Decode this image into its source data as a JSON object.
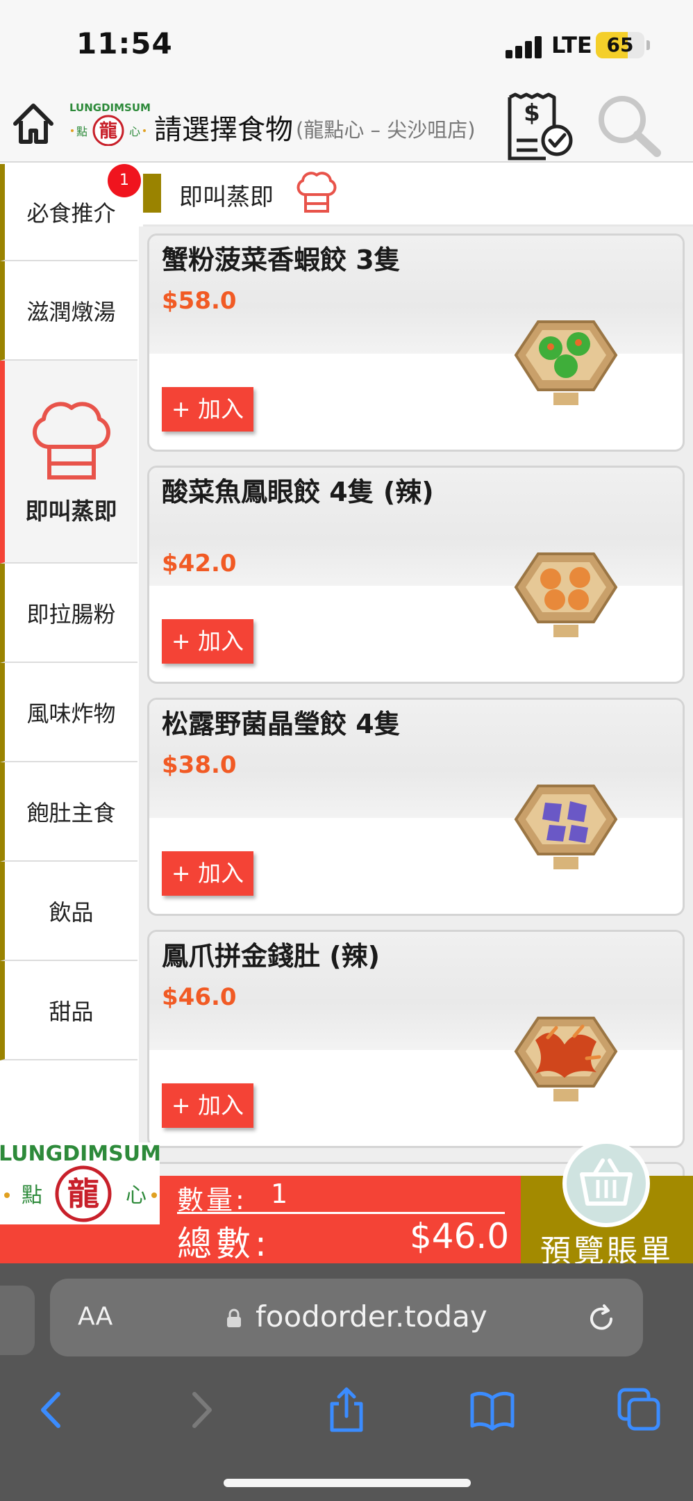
{
  "status_bar": {
    "time": "11:54",
    "network": "LTE",
    "battery": "65",
    "battery_level": 0.65
  },
  "header": {
    "title": "請選擇食物",
    "subtitle": "(龍點心 – 尖沙咀店)",
    "logo_text_top": "LUNGDIMSUM",
    "logo_text_bottom": "點 龍 心"
  },
  "sidebar": {
    "items": [
      {
        "label": "必食推介",
        "badge": "1"
      },
      {
        "label": "滋潤燉湯"
      },
      {
        "label": "即叫蒸即",
        "active": true
      },
      {
        "label": "即拉腸粉"
      },
      {
        "label": "風味炸物"
      },
      {
        "label": "飽肚主食"
      },
      {
        "label": "飲品"
      },
      {
        "label": "甜品"
      }
    ],
    "bottom_logo_top": "LUNGDIMSUM",
    "bottom_logo_bottom": "點 龍 心"
  },
  "category": {
    "title": "即叫蒸即"
  },
  "menu_items": [
    {
      "name": "蟹粉菠菜香蝦餃 3隻",
      "price": "$58.0",
      "add_label": "+ 加入",
      "fill_color": "#3fae3a"
    },
    {
      "name": "酸菜魚鳳眼餃 4隻 (辣)",
      "price": "$42.0",
      "add_label": "+ 加入",
      "fill_color": "#e8893a"
    },
    {
      "name": "松露野菌晶瑩餃 4隻",
      "price": "$38.0",
      "add_label": "+ 加入",
      "fill_color": "#6a58c6"
    },
    {
      "name": "鳳爪拼金錢肚 (辣)",
      "price": "$46.0",
      "add_label": "+ 加入",
      "fill_color": "#d0461c"
    }
  ],
  "order_summary": {
    "quantity_label": "數量:",
    "quantity_value": "1",
    "total_label": "總數:",
    "total_value": "$46.0",
    "preview_label": "預覽賬單"
  },
  "browser": {
    "text_size_label": "AA",
    "url": "foodorder.today"
  },
  "colors": {
    "accent_red": "#f44336",
    "accent_gold": "#a38a00",
    "price_orange": "#f15a24",
    "browser_chrome": "#565656"
  }
}
